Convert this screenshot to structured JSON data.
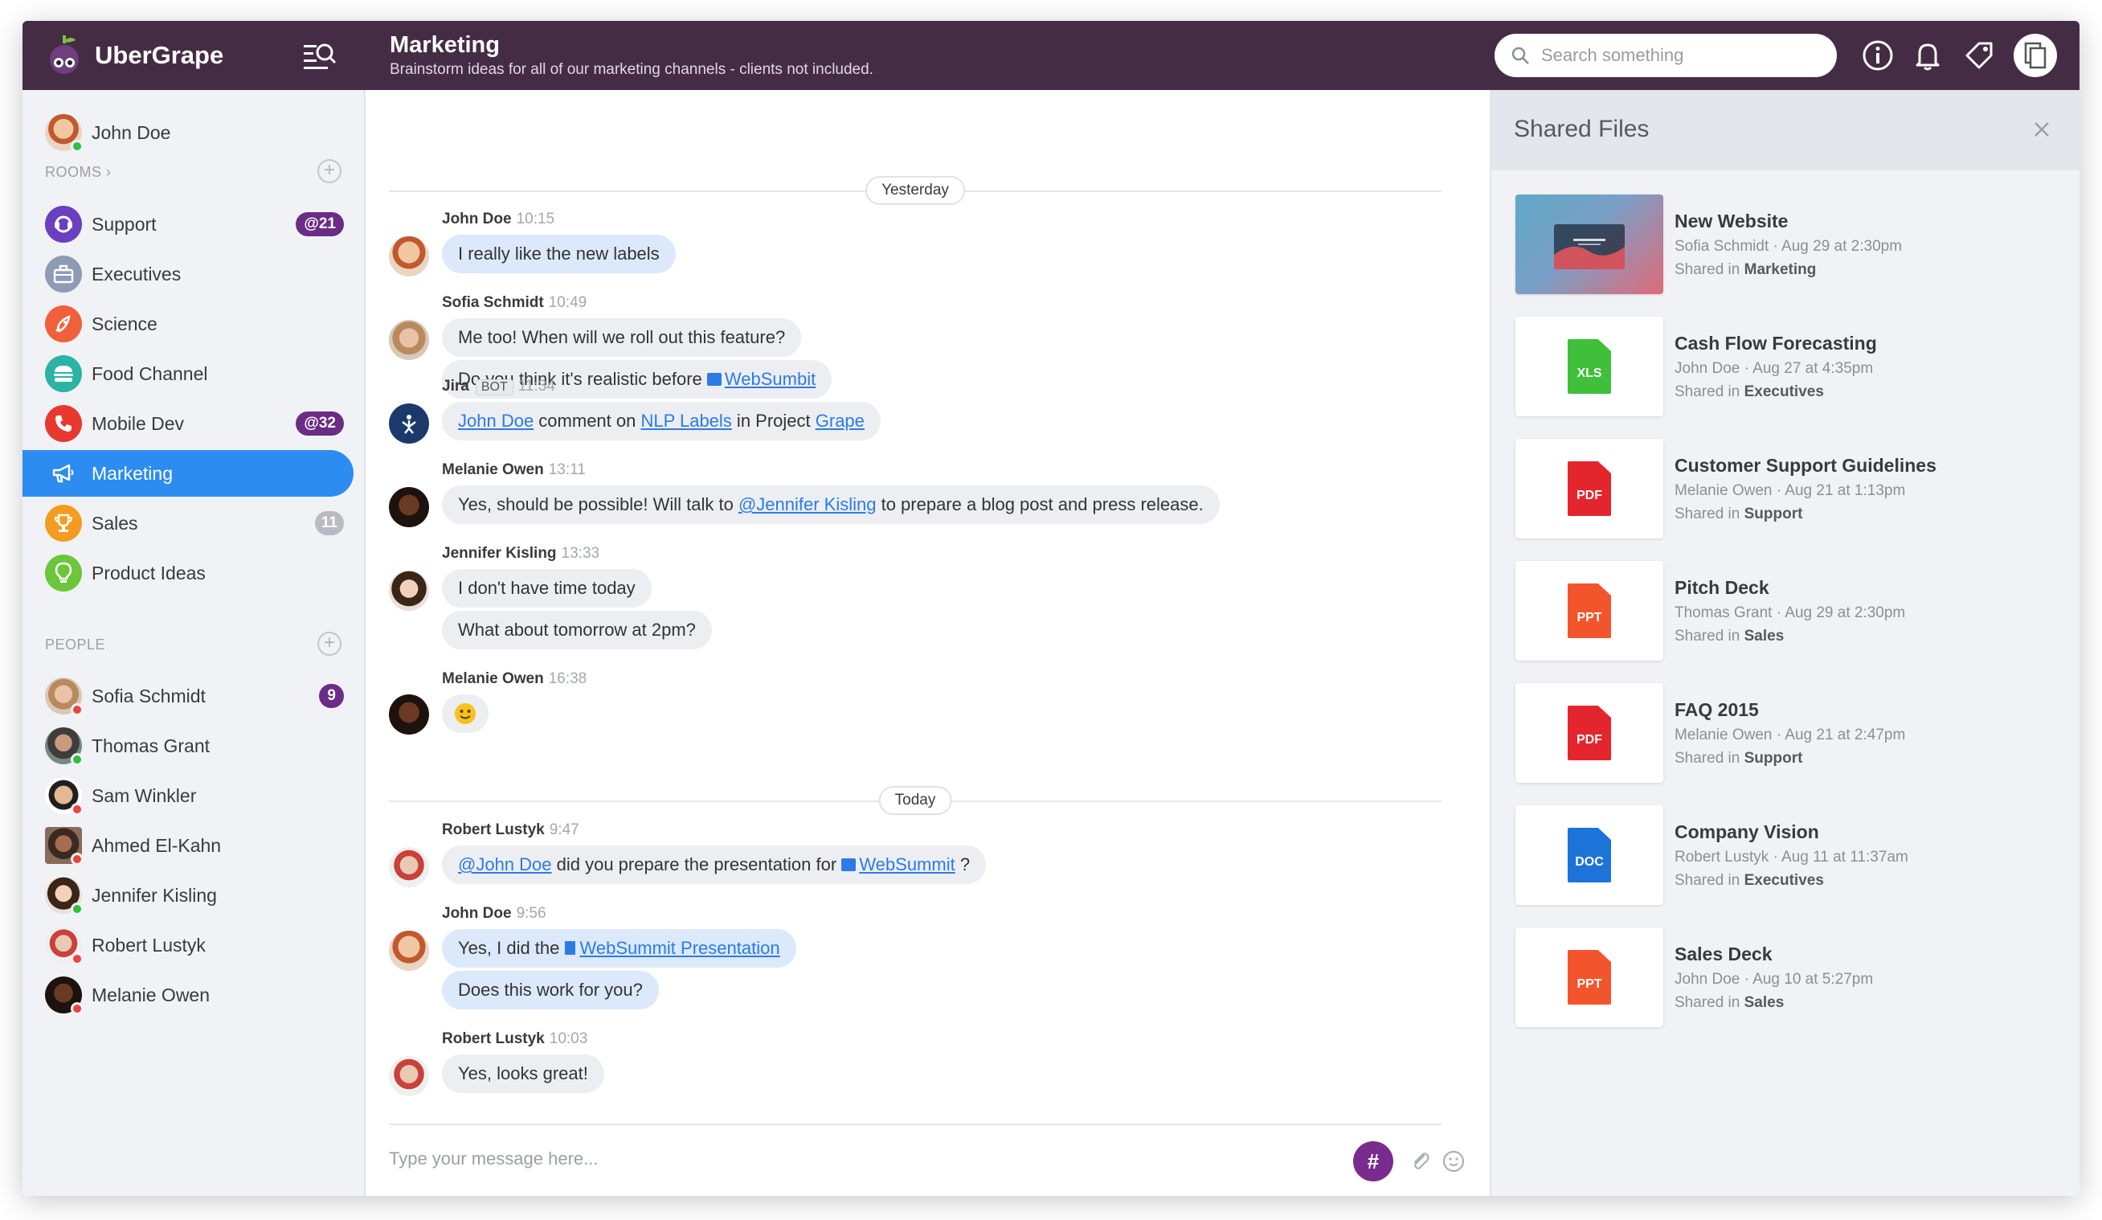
{
  "app": {
    "name": "UberGrape"
  },
  "room": {
    "title": "Marketing",
    "subtitle": "Brainstorm ideas for all of our marketing channels - clients not included."
  },
  "search": {
    "placeholder": "Search something"
  },
  "user": {
    "name": "John Doe",
    "status_color": "#2fbf3b"
  },
  "sidebar": {
    "rooms_label": "ROOMS",
    "rooms_chevron": "›",
    "people_label": "PEOPLE",
    "rooms": [
      {
        "name": "Support",
        "badge": "@21",
        "color": "#6a3fc0",
        "icon": "support-icon"
      },
      {
        "name": "Executives",
        "badge": "",
        "color": "#8e9bb4",
        "icon": "briefcase-icon"
      },
      {
        "name": "Science",
        "badge": "",
        "color": "#f0603a",
        "icon": "rocket-icon"
      },
      {
        "name": "Food Channel",
        "badge": "",
        "color": "#2bb3a5",
        "icon": "burger-icon"
      },
      {
        "name": "Mobile Dev",
        "badge": "@32",
        "color": "#e8382f",
        "icon": "phone-icon"
      },
      {
        "name": "Marketing",
        "badge": "",
        "color": "#2c8cf0",
        "icon": "megaphone-icon"
      },
      {
        "name": "Sales",
        "badge": "11",
        "color": "#f39c1f",
        "icon": "trophy-icon"
      },
      {
        "name": "Product Ideas",
        "badge": "",
        "color": "#6cc63b",
        "icon": "lightbulb-icon"
      }
    ],
    "people": [
      {
        "name": "Sofia Schmidt",
        "badge": "9",
        "status": "#e8453c"
      },
      {
        "name": "Thomas Grant",
        "badge": "",
        "status": "#2fbf3b"
      },
      {
        "name": "Sam Winkler",
        "badge": "",
        "status": "#e8453c"
      },
      {
        "name": "Ahmed El-Kahn",
        "badge": "",
        "status": "#e8453c"
      },
      {
        "name": "Jennifer Kisling",
        "badge": "",
        "status": "#2fbf3b"
      },
      {
        "name": "Robert Lustyk",
        "badge": "",
        "status": "#e8453c"
      },
      {
        "name": "Melanie Owen",
        "badge": "",
        "status": "#e8453c"
      }
    ]
  },
  "chat": {
    "day1": "Yesterday",
    "day2": "Today",
    "messages": [
      {
        "author": "John Doe",
        "time": "10:15",
        "text": "I really like the new labels"
      },
      {
        "author": "Sofia Schmidt",
        "time": "10:49",
        "text": "Me too! When will we roll out this feature?",
        "text2a": "Do you think it's realistic before ",
        "text2link": "WebSumbit"
      },
      {
        "author": "Jira",
        "bot": "BOT",
        "time": "11:34",
        "link1": "John Doe",
        "mid1": " comment on ",
        "link2": "NLP Labels",
        "mid2": " in Project ",
        "link3": "Grape"
      },
      {
        "author": "Melanie Owen",
        "time": "13:11",
        "pre": "Yes, should be possible! Will talk to ",
        "link": "@Jennifer Kisling",
        "post": " to prepare a blog post and press release."
      },
      {
        "author": "Jennifer Kisling",
        "time": "13:33",
        "text": "I don't have time today",
        "text2": "What about tomorrow at 2pm?"
      },
      {
        "author": "Melanie Owen",
        "time": "16:38",
        "emoji": "🙂"
      },
      {
        "author": "Robert Lustyk",
        "time": "9:47",
        "link1": "@John Doe",
        "mid": " did you prepare the presentation for ",
        "link2": "WebSummit",
        "post": " ?"
      },
      {
        "author": "John Doe",
        "time": "9:56",
        "pre": "Yes, I did the ",
        "link": "WebSummit Presentation",
        "text2": "Does this work for you?"
      },
      {
        "author": "Robert Lustyk",
        "time": "10:03",
        "text": "Yes, looks great!"
      }
    ],
    "composer_placeholder": "Type your message here...",
    "hash_label": "#"
  },
  "panel": {
    "title": "Shared Files",
    "shared_in_prefix": "Shared in ",
    "files": [
      {
        "name": "New Website",
        "meta": "Sofia Schmidt · Aug 29 at 2:30pm",
        "room": "Marketing",
        "type": "",
        "color": ""
      },
      {
        "name": "Cash Flow Forecasting",
        "meta": "John Doe · Aug 27 at 4:35pm",
        "room": "Executives",
        "type": "XLS",
        "color": "#3fbf3a"
      },
      {
        "name": "Customer Support Guidelines",
        "meta": "Melanie Owen · Aug 21 at 1:13pm",
        "room": "Support",
        "type": "PDF",
        "color": "#e3262d"
      },
      {
        "name": "Pitch Deck",
        "meta": "Thomas Grant · Aug 29 at 2:30pm",
        "room": "Sales",
        "type": "PPT",
        "color": "#f2552c"
      },
      {
        "name": "FAQ 2015",
        "meta": "Melanie Owen · Aug 21 at 2:47pm",
        "room": "Support",
        "type": "PDF",
        "color": "#e3262d"
      },
      {
        "name": "Company Vision",
        "meta": "Robert Lustyk · Aug 11 at 11:37am",
        "room": "Executives",
        "type": "DOC",
        "color": "#1c74d9"
      },
      {
        "name": "Sales Deck",
        "meta": "John Doe · Aug 10 at 5:27pm",
        "room": "Sales",
        "type": "PPT",
        "color": "#f2552c"
      }
    ]
  },
  "colors": {
    "header": "#452c45",
    "accent": "#2c8cf0",
    "badge": "#6a2c84"
  }
}
